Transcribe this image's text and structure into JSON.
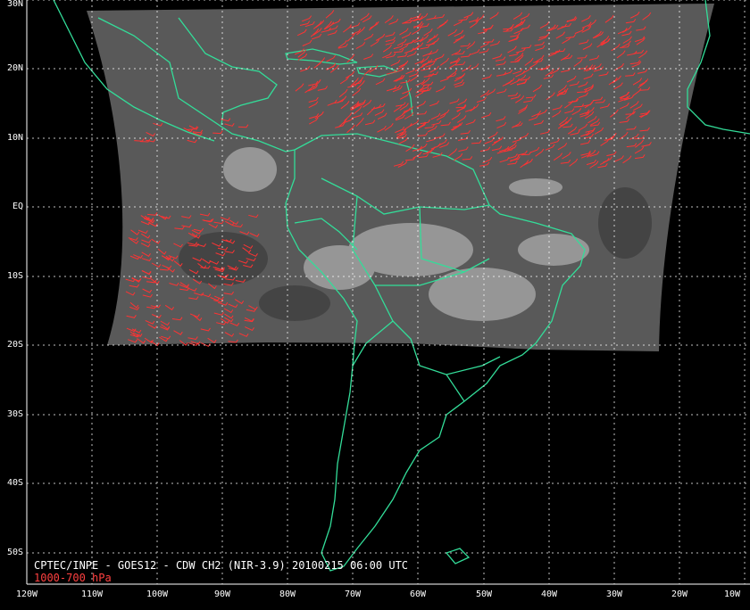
{
  "caption": {
    "title": "CPTEC/INPE - GOES12 - CDW CH2 (NIR-3.9) 20100215 06:00 UTC",
    "level": "1000-700 hPa"
  },
  "lat_labels": [
    "30N",
    "20N",
    "10N",
    "EQ",
    "10S",
    "20S",
    "30S",
    "40S",
    "50S"
  ],
  "lon_labels": [
    "120W",
    "110W",
    "100W",
    "90W",
    "80W",
    "70W",
    "60W",
    "50W",
    "40W",
    "30W",
    "20W",
    "10W"
  ],
  "colors": {
    "background": "#000000",
    "grid": "#ffffff",
    "coastline": "#33dd99",
    "wind_barbs": "#ff3333",
    "satellite_image": "#6a6a6a"
  },
  "map": {
    "projection": "cylindrical",
    "lon_range": [
      -120,
      -10
    ],
    "lat_range": [
      -55,
      30
    ],
    "grid_spacing_deg": 10,
    "grid_style": "dotted"
  }
}
